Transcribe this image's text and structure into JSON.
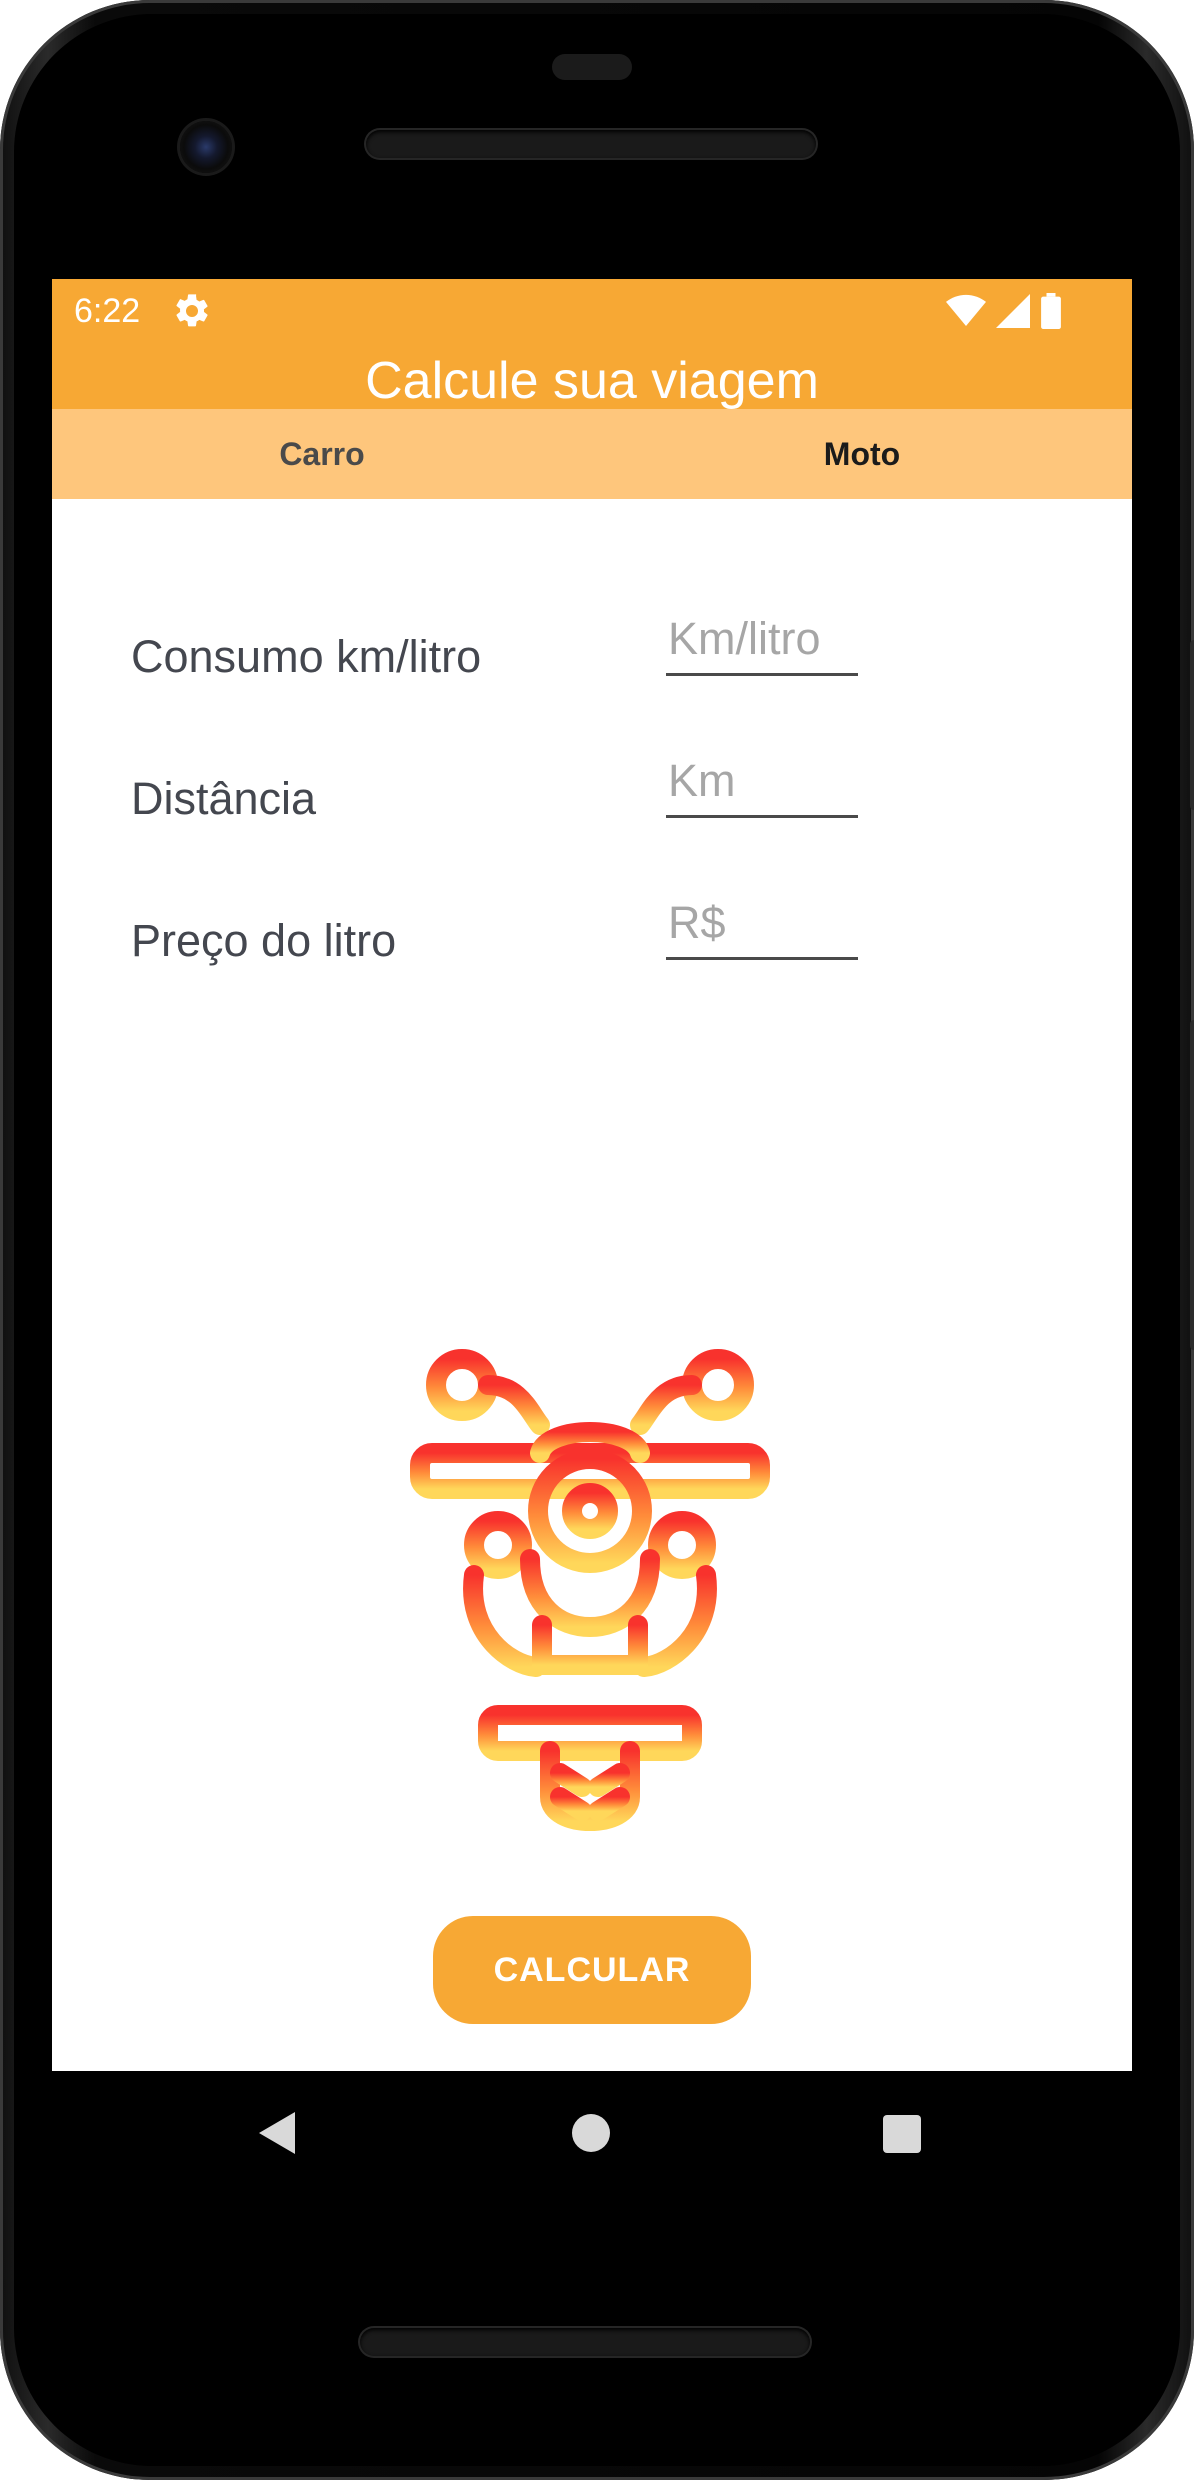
{
  "status_bar": {
    "time": "6:22",
    "icons": [
      "gear-icon",
      "wifi-icon",
      "signal-icon",
      "battery-icon"
    ]
  },
  "app_bar": {
    "title": "Calcule sua viagem"
  },
  "tabs": [
    {
      "label": "Carro",
      "selected": false
    },
    {
      "label": "Moto",
      "selected": true
    }
  ],
  "form": {
    "fields": [
      {
        "label": "Consumo km/litro",
        "placeholder": "Km/litro",
        "value": ""
      },
      {
        "label": "Distância",
        "placeholder": "Km",
        "value": ""
      },
      {
        "label": "Preço do litro",
        "placeholder": "R$",
        "value": ""
      }
    ]
  },
  "illustration": {
    "icon": "motorcycle-icon",
    "gradient": [
      "#f8322d",
      "#ffd75a"
    ]
  },
  "actions": {
    "calculate_label": "CALCULAR"
  },
  "colors": {
    "primary": "#f7a834",
    "tab_background": "#fec67c",
    "on_primary": "#ffffff"
  },
  "nav_bar": {
    "icons": [
      "back-icon",
      "home-icon",
      "recents-icon"
    ]
  }
}
